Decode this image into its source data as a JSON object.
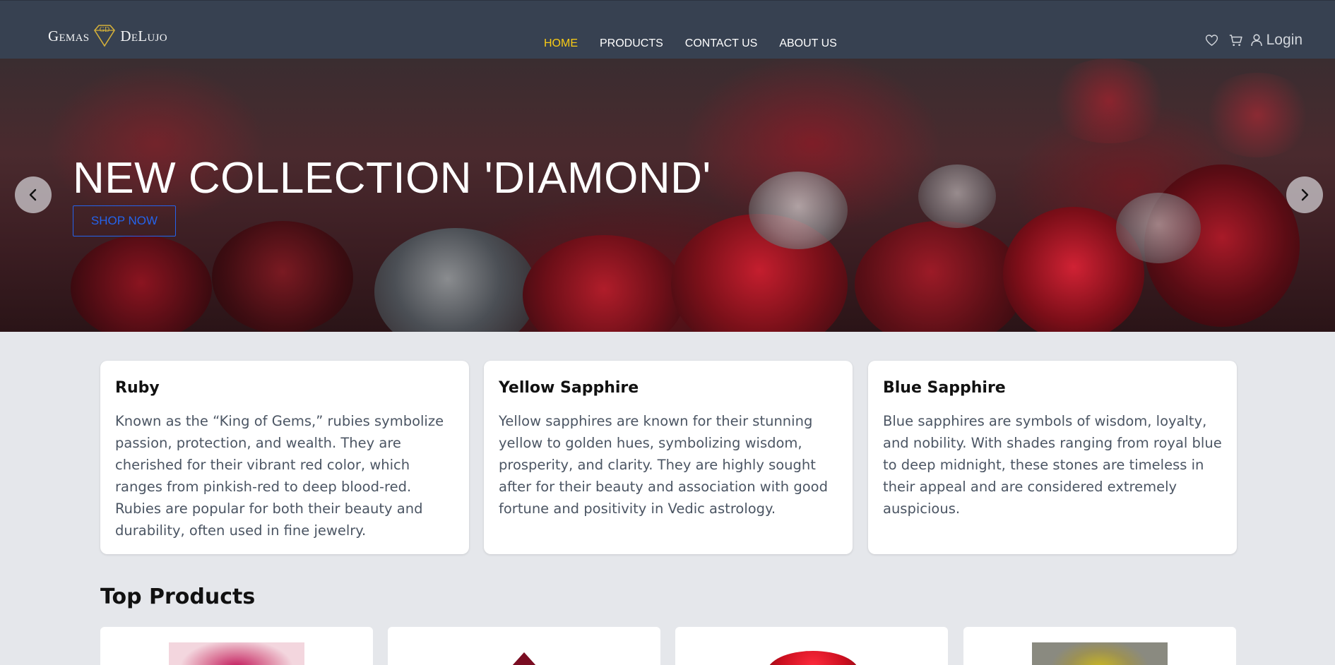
{
  "brand": {
    "logo_text_left": "Gemas",
    "logo_monogram": "GD",
    "logo_text_right": "DeLujo"
  },
  "nav": {
    "items": [
      {
        "label": "HOME",
        "active": true
      },
      {
        "label": "PRODUCTS",
        "active": false
      },
      {
        "label": "CONTACT US",
        "active": false
      },
      {
        "label": "ABOUT US",
        "active": false
      }
    ],
    "active_color": "#facc15"
  },
  "header_icons": {
    "wishlist": "heart-icon",
    "cart": "cart-icon",
    "user": "user-icon",
    "login_label": "Login"
  },
  "hero": {
    "title": "NEW COLLECTION 'DIAMOND'",
    "cta_label": "SHOP NOW",
    "prev_icon": "chevron-left-icon",
    "next_icon": "chevron-right-icon"
  },
  "gem_cards": [
    {
      "title": "Ruby",
      "description": "Known as the “King of Gems,” rubies symbolize passion, protection, and wealth. They are cherished for their vibrant red color, which ranges from pinkish-red to deep blood-red. Rubies are popular for both their beauty and durability, often used in fine jewelry."
    },
    {
      "title": "Yellow Sapphire",
      "description": "Yellow sapphires are known for their stunning yellow to golden hues, symbolizing wisdom, prosperity, and clarity. They are highly sought after for their beauty and association with good fortune and positivity in Vedic astrology."
    },
    {
      "title": "Blue Sapphire",
      "description": "Blue sapphires are symbols of wisdom, loyalty, and nobility. With shades ranging from royal blue to deep midnight, these stones are timeless in their appeal and are considered extremely auspicious."
    }
  ],
  "top_products": {
    "title": "Top Products"
  },
  "colors": {
    "header_bg": "#374151",
    "page_bg": "#e5e7eb",
    "cta": "#2563eb"
  }
}
